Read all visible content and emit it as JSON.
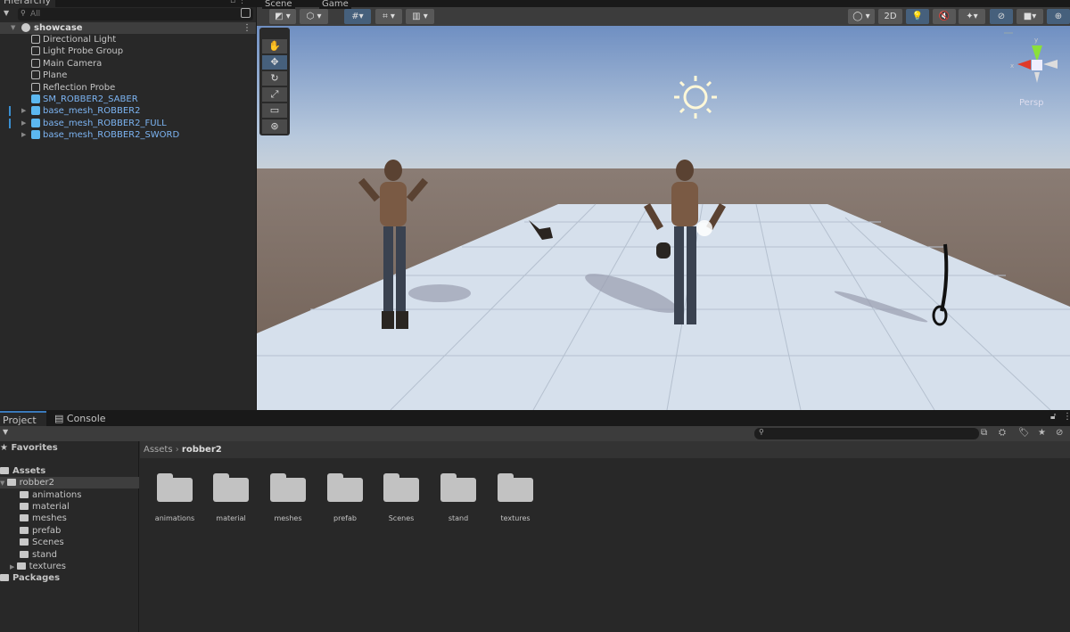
{
  "hierarchy": {
    "tab": "Hierarchy",
    "search_placeholder": "All",
    "scene_name": "showcase",
    "items": [
      {
        "label": "Directional Light",
        "type": "gameobject"
      },
      {
        "label": "Light Probe Group",
        "type": "gameobject"
      },
      {
        "label": "Main Camera",
        "type": "gameobject"
      },
      {
        "label": "Plane",
        "type": "gameobject"
      },
      {
        "label": "Reflection Probe",
        "type": "gameobject"
      },
      {
        "label": "SM_ROBBER2_SABER",
        "type": "prefab"
      },
      {
        "label": "base_mesh_ROBBER2",
        "type": "prefab",
        "expandable": true
      },
      {
        "label": "base_mesh_ROBBER2_FULL",
        "type": "prefab",
        "expandable": true
      },
      {
        "label": "base_mesh_ROBBER2_SWORD",
        "type": "prefab",
        "expandable": true
      }
    ]
  },
  "scene": {
    "tabs": [
      "Scene",
      "Game"
    ],
    "toolbar": {
      "mode_2d": "2D"
    },
    "gizmo": {
      "y": "y",
      "x": "x",
      "projection": "Persp"
    },
    "colors": {
      "sky_top": "#6f8fc0",
      "ground": "#7d6a5f",
      "plane": "#d9e3ee",
      "selected": "#46607c"
    }
  },
  "project": {
    "tabs": [
      "Project",
      "Console"
    ],
    "tree": {
      "favorites": "Favorites",
      "assets": "Assets",
      "selected": "robber2",
      "children": [
        "animations",
        "material",
        "meshes",
        "prefab",
        "Scenes",
        "stand",
        "textures"
      ],
      "packages": "Packages"
    },
    "breadcrumb": [
      "Assets",
      "robber2"
    ],
    "folders": [
      "animations",
      "material",
      "meshes",
      "prefab",
      "Scenes",
      "stand",
      "textures"
    ]
  }
}
